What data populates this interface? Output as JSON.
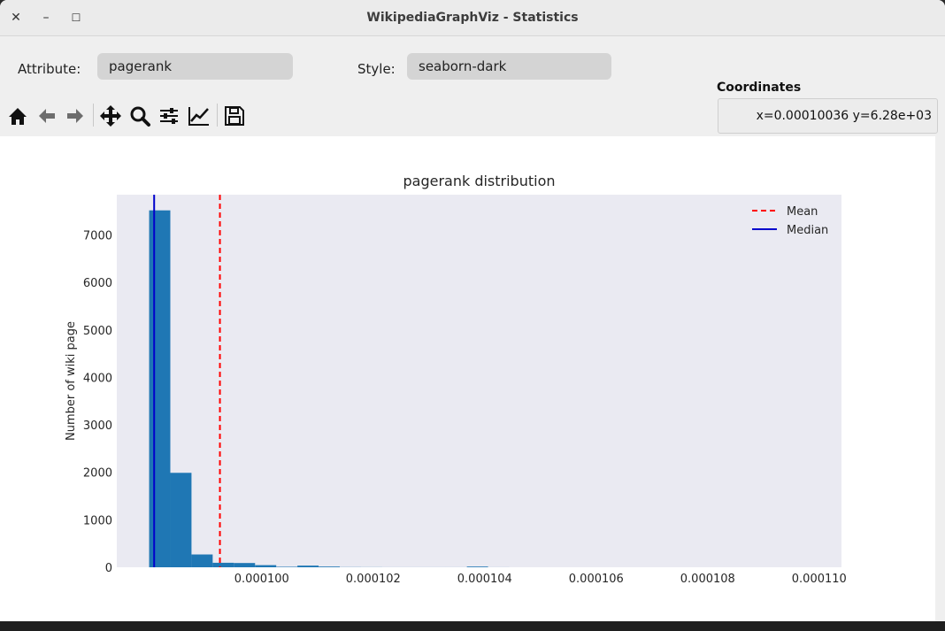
{
  "window": {
    "title": "WikipediaGraphViz - Statistics",
    "close_glyph": "✕",
    "minimize_glyph": "–",
    "maximize_glyph": "☐"
  },
  "controls": {
    "attribute_label": "Attribute:",
    "attribute_value": "pagerank",
    "style_label": "Style:",
    "style_value": "seaborn-dark"
  },
  "toolbar": {
    "icons": [
      "home-icon",
      "back-arrow-icon",
      "forward-arrow-icon",
      "pan-icon",
      "zoom-icon",
      "configure-subplots-icon",
      "edit-axis-icon",
      "save-icon"
    ]
  },
  "coordinates": {
    "label": "Coordinates",
    "value": "x=0.00010036 y=6.28e+03"
  },
  "colors": {
    "bar": "#1f77b4",
    "mean": "#ff0000",
    "median": "#0000cc",
    "axes_bg": "#eaeaf2"
  },
  "chart_data": {
    "type": "bar",
    "title": "pagerank distribution",
    "xlabel": "",
    "ylabel": "Number of wiki page",
    "xlim": [
      9.74e-05,
      0.0001104
    ],
    "ylim": [
      0,
      7850
    ],
    "yticks": [
      0,
      1000,
      2000,
      3000,
      4000,
      5000,
      6000,
      7000
    ],
    "xticks": [
      0.0001,
      0.000102,
      0.000104,
      0.000106,
      0.000108,
      0.00011
    ],
    "xtick_labels": [
      "0.000100",
      "0.000102",
      "0.000104",
      "0.000106",
      "0.000108",
      "0.000110"
    ],
    "bin_edges": [
      9.798e-05,
      9.836e-05,
      9.874e-05,
      9.912e-05,
      9.95e-05,
      9.988e-05,
      0.00010026,
      0.00010064,
      0.00010102,
      0.0001014,
      0.00010178,
      0.00010216,
      0.00010254,
      0.00010292,
      0.0001033,
      0.00010368,
      0.00010406,
      0.00010444
    ],
    "counts": [
      7520,
      1990,
      270,
      95,
      90,
      45,
      10,
      35,
      15,
      3,
      2,
      1,
      1,
      1,
      1,
      15,
      1
    ],
    "mean": 9.925e-05,
    "median": 9.807e-05,
    "legend": [
      {
        "name": "Mean",
        "style": "dashed",
        "color": "#ff0000"
      },
      {
        "name": "Median",
        "style": "solid",
        "color": "#0000cc"
      }
    ],
    "legend_position": "top-right",
    "grid": false
  }
}
